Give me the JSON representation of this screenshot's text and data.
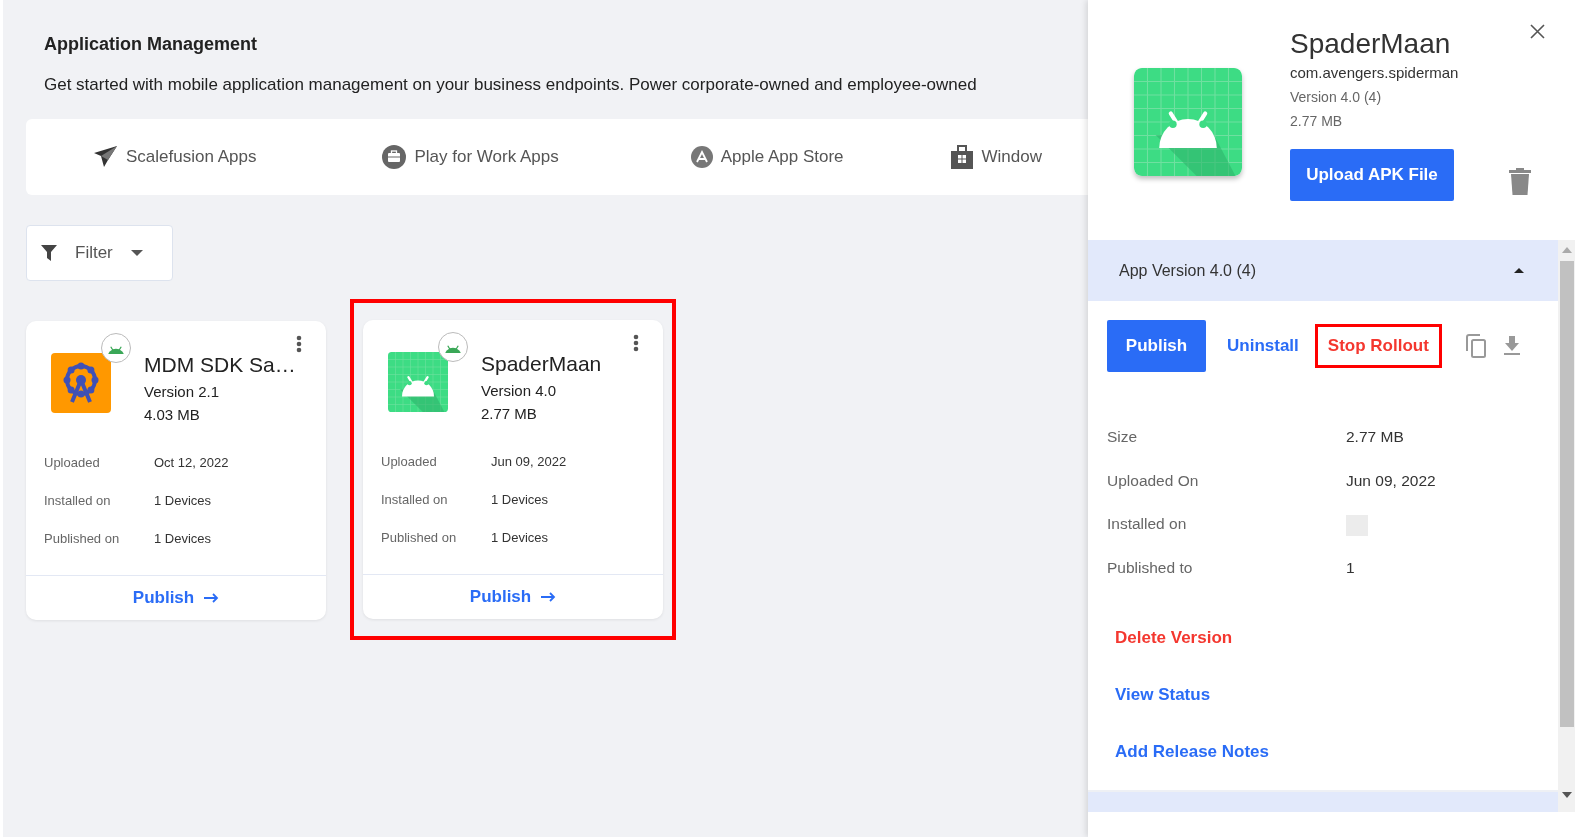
{
  "page": {
    "title": "Application Management",
    "description": "Get started with mobile application management on your business endpoints. Power corporate-owned and employee-owned"
  },
  "store_tabs": [
    {
      "label": "Scalefusion Apps",
      "kind": "scalefusion"
    },
    {
      "label": "Play for Work Apps",
      "kind": "play"
    },
    {
      "label": "Apple App Store",
      "kind": "apple"
    },
    {
      "label": "Window",
      "kind": "windows"
    }
  ],
  "filter": {
    "label": "Filter"
  },
  "apps": [
    {
      "name": "MDM SDK Sa…",
      "version": "Version 2.1",
      "size": "4.03 MB",
      "kind": "sdk",
      "highlighted": false,
      "details": [
        {
          "label": "Uploaded",
          "value": "Oct 12, 2022"
        },
        {
          "label": "Installed on",
          "value": "1 Devices"
        },
        {
          "label": "Published on",
          "value": "1 Devices"
        }
      ],
      "action": "Publish"
    },
    {
      "name": "SpaderMaan",
      "version": "Version 4.0",
      "size": "2.77 MB",
      "kind": "android",
      "highlighted": true,
      "details": [
        {
          "label": "Uploaded",
          "value": "Jun 09, 2022"
        },
        {
          "label": "Installed on",
          "value": "1 Devices"
        },
        {
          "label": "Published on",
          "value": "1 Devices"
        }
      ],
      "action": "Publish"
    }
  ],
  "panel": {
    "name": "SpaderMaan",
    "package": "com.avengers.spiderman",
    "version": "Version 4.0 (4)",
    "size": "2.77 MB",
    "upload_button": "Upload APK File",
    "version_section": {
      "title": "App Version 4.0 (4)",
      "expanded": true,
      "actions": [
        {
          "label": "Publish",
          "kind": "primary",
          "highlighted": false
        },
        {
          "label": "Uninstall",
          "kind": "link",
          "highlighted": false
        },
        {
          "label": "Stop Rollout",
          "kind": "danger",
          "highlighted": true
        }
      ],
      "details": [
        {
          "label": "Size",
          "value": "2.77 MB"
        },
        {
          "label": "Uploaded On",
          "value": "Jun 09, 2022"
        },
        {
          "label": "Installed on"
        },
        {
          "label": "Published to",
          "value": "1"
        }
      ],
      "links": [
        {
          "label": "Delete Version",
          "kind": "danger"
        },
        {
          "label": "View Status",
          "kind": "link"
        },
        {
          "label": "Add Release Notes",
          "kind": "link"
        }
      ]
    }
  }
}
